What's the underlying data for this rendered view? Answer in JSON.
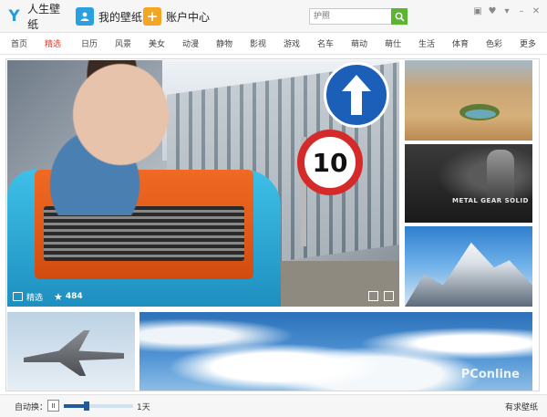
{
  "titlebar": {
    "home_tab": "人生壁纸",
    "mine_tab": "我的壁纸",
    "account_tab": "账户中心",
    "search_placeholder": "护照"
  },
  "nav": {
    "items": [
      "首页",
      "精选",
      "日历",
      "风景",
      "美女",
      "动漫",
      "静物",
      "影视",
      "游戏",
      "名车",
      "萌动",
      "萌仕",
      "生活",
      "体育",
      "色彩",
      "更多"
    ],
    "active_index": 1,
    "accent_color": "#e23a2e"
  },
  "feature": {
    "caption": "精选",
    "favorites_count": "484",
    "sign_number": "10"
  },
  "tiles": {
    "metal_gear_logo": "METAL GEAR SOLID"
  },
  "watermark": "PConline",
  "statusbar": {
    "autoswitch_label": "自动换：",
    "pause_symbol": "II",
    "interval_value": "1天",
    "interval_fraction": 0.33,
    "exit_label": "有求壁纸"
  },
  "icons": {
    "home": "blue-y-logo-icon",
    "mine": "user-icon",
    "account": "plus-icon",
    "search": "search-icon"
  },
  "colors": {
    "search_button": "#5cb531",
    "mine_icon": "#2aa0e0",
    "account_icon": "#f4a623"
  }
}
